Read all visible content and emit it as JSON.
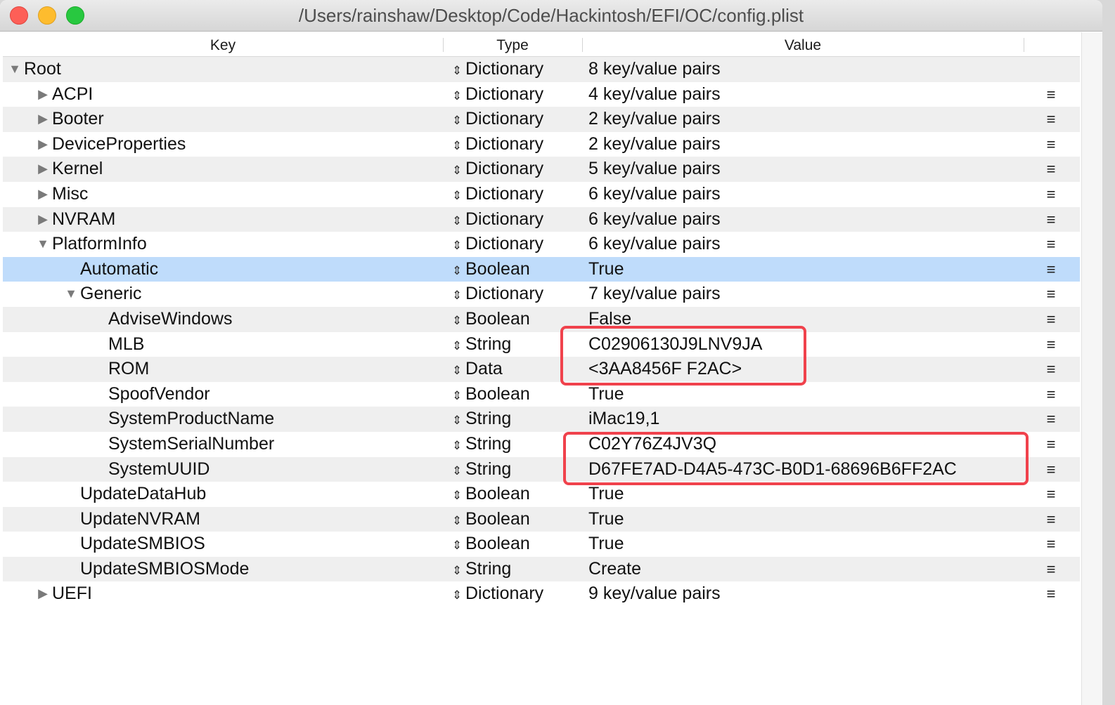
{
  "window": {
    "title": "/Users/rainshaw/Desktop/Code/Hackintosh/EFI/OC/config.plist"
  },
  "columns": {
    "key": "Key",
    "type": "Type",
    "value": "Value"
  },
  "colors": {
    "selection": "#bfdcfb",
    "highlight_box": "#f0424c",
    "stripe": "#efefef"
  },
  "rows": [
    {
      "key": "Root",
      "depth": 0,
      "disclosure": "expanded",
      "type": "Dictionary",
      "value": "8 key/value pairs",
      "menu": false
    },
    {
      "key": "ACPI",
      "depth": 1,
      "disclosure": "collapsed",
      "type": "Dictionary",
      "value": "4 key/value pairs",
      "menu": true
    },
    {
      "key": "Booter",
      "depth": 1,
      "disclosure": "collapsed",
      "type": "Dictionary",
      "value": "2 key/value pairs",
      "menu": true
    },
    {
      "key": "DeviceProperties",
      "depth": 1,
      "disclosure": "collapsed",
      "type": "Dictionary",
      "value": "2 key/value pairs",
      "menu": true
    },
    {
      "key": "Kernel",
      "depth": 1,
      "disclosure": "collapsed",
      "type": "Dictionary",
      "value": "5 key/value pairs",
      "menu": true
    },
    {
      "key": "Misc",
      "depth": 1,
      "disclosure": "collapsed",
      "type": "Dictionary",
      "value": "6 key/value pairs",
      "menu": true
    },
    {
      "key": "NVRAM",
      "depth": 1,
      "disclosure": "collapsed",
      "type": "Dictionary",
      "value": "6 key/value pairs",
      "menu": true
    },
    {
      "key": "PlatformInfo",
      "depth": 1,
      "disclosure": "expanded",
      "type": "Dictionary",
      "value": "6 key/value pairs",
      "menu": true
    },
    {
      "key": "Automatic",
      "depth": 2,
      "disclosure": "none",
      "type": "Boolean",
      "value": "True",
      "menu": true,
      "selected": true
    },
    {
      "key": "Generic",
      "depth": 2,
      "disclosure": "expanded",
      "type": "Dictionary",
      "value": "7 key/value pairs",
      "menu": true
    },
    {
      "key": "AdviseWindows",
      "depth": 3,
      "disclosure": "none",
      "type": "Boolean",
      "value": "False",
      "menu": true
    },
    {
      "key": "MLB",
      "depth": 3,
      "disclosure": "none",
      "type": "String",
      "value": "C02906130J9LNV9JA",
      "menu": true
    },
    {
      "key": "ROM",
      "depth": 3,
      "disclosure": "none",
      "type": "Data",
      "value": "<3AA8456F F2AC>",
      "menu": true
    },
    {
      "key": "SpoofVendor",
      "depth": 3,
      "disclosure": "none",
      "type": "Boolean",
      "value": "True",
      "menu": true
    },
    {
      "key": "SystemProductName",
      "depth": 3,
      "disclosure": "none",
      "type": "String",
      "value": "iMac19,1",
      "menu": true
    },
    {
      "key": "SystemSerialNumber",
      "depth": 3,
      "disclosure": "none",
      "type": "String",
      "value": "C02Y76Z4JV3Q",
      "menu": true
    },
    {
      "key": "SystemUUID",
      "depth": 3,
      "disclosure": "none",
      "type": "String",
      "value": "D67FE7AD-D4A5-473C-B0D1-68696B6FF2AC",
      "menu": true
    },
    {
      "key": "UpdateDataHub",
      "depth": 2,
      "disclosure": "none",
      "type": "Boolean",
      "value": "True",
      "menu": true
    },
    {
      "key": "UpdateNVRAM",
      "depth": 2,
      "disclosure": "none",
      "type": "Boolean",
      "value": "True",
      "menu": true
    },
    {
      "key": "UpdateSMBIOS",
      "depth": 2,
      "disclosure": "none",
      "type": "Boolean",
      "value": "True",
      "menu": true
    },
    {
      "key": "UpdateSMBIOSMode",
      "depth": 2,
      "disclosure": "none",
      "type": "String",
      "value": "Create",
      "menu": true
    },
    {
      "key": "UEFI",
      "depth": 1,
      "disclosure": "collapsed",
      "type": "Dictionary",
      "value": "9 key/value pairs",
      "menu": true
    }
  ],
  "icons": {
    "expanded": "disclosure-expanded-icon",
    "collapsed": "disclosure-collapsed-icon",
    "type_popup": "type-popup-arrows-icon",
    "row_menu": "row-menu-icon"
  }
}
